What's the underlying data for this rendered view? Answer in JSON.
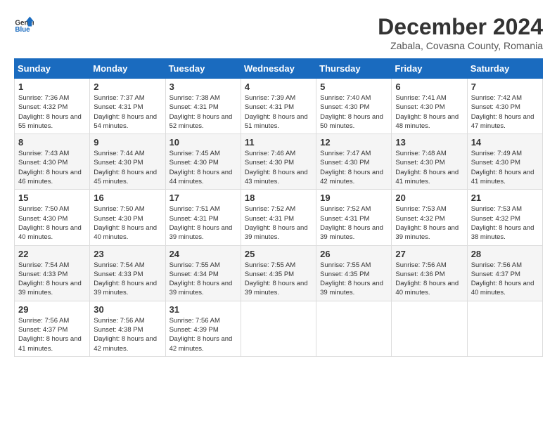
{
  "logo": {
    "general": "General",
    "blue": "Blue"
  },
  "title": "December 2024",
  "location": "Zabala, Covasna County, Romania",
  "days_header": [
    "Sunday",
    "Monday",
    "Tuesday",
    "Wednesday",
    "Thursday",
    "Friday",
    "Saturday"
  ],
  "weeks": [
    [
      {
        "day": "1",
        "sunrise": "7:36 AM",
        "sunset": "4:32 PM",
        "daylight": "8 hours and 55 minutes."
      },
      {
        "day": "2",
        "sunrise": "7:37 AM",
        "sunset": "4:31 PM",
        "daylight": "8 hours and 54 minutes."
      },
      {
        "day": "3",
        "sunrise": "7:38 AM",
        "sunset": "4:31 PM",
        "daylight": "8 hours and 52 minutes."
      },
      {
        "day": "4",
        "sunrise": "7:39 AM",
        "sunset": "4:31 PM",
        "daylight": "8 hours and 51 minutes."
      },
      {
        "day": "5",
        "sunrise": "7:40 AM",
        "sunset": "4:30 PM",
        "daylight": "8 hours and 50 minutes."
      },
      {
        "day": "6",
        "sunrise": "7:41 AM",
        "sunset": "4:30 PM",
        "daylight": "8 hours and 48 minutes."
      },
      {
        "day": "7",
        "sunrise": "7:42 AM",
        "sunset": "4:30 PM",
        "daylight": "8 hours and 47 minutes."
      }
    ],
    [
      {
        "day": "8",
        "sunrise": "7:43 AM",
        "sunset": "4:30 PM",
        "daylight": "8 hours and 46 minutes."
      },
      {
        "day": "9",
        "sunrise": "7:44 AM",
        "sunset": "4:30 PM",
        "daylight": "8 hours and 45 minutes."
      },
      {
        "day": "10",
        "sunrise": "7:45 AM",
        "sunset": "4:30 PM",
        "daylight": "8 hours and 44 minutes."
      },
      {
        "day": "11",
        "sunrise": "7:46 AM",
        "sunset": "4:30 PM",
        "daylight": "8 hours and 43 minutes."
      },
      {
        "day": "12",
        "sunrise": "7:47 AM",
        "sunset": "4:30 PM",
        "daylight": "8 hours and 42 minutes."
      },
      {
        "day": "13",
        "sunrise": "7:48 AM",
        "sunset": "4:30 PM",
        "daylight": "8 hours and 41 minutes."
      },
      {
        "day": "14",
        "sunrise": "7:49 AM",
        "sunset": "4:30 PM",
        "daylight": "8 hours and 41 minutes."
      }
    ],
    [
      {
        "day": "15",
        "sunrise": "7:50 AM",
        "sunset": "4:30 PM",
        "daylight": "8 hours and 40 minutes."
      },
      {
        "day": "16",
        "sunrise": "7:50 AM",
        "sunset": "4:30 PM",
        "daylight": "8 hours and 40 minutes."
      },
      {
        "day": "17",
        "sunrise": "7:51 AM",
        "sunset": "4:31 PM",
        "daylight": "8 hours and 39 minutes."
      },
      {
        "day": "18",
        "sunrise": "7:52 AM",
        "sunset": "4:31 PM",
        "daylight": "8 hours and 39 minutes."
      },
      {
        "day": "19",
        "sunrise": "7:52 AM",
        "sunset": "4:31 PM",
        "daylight": "8 hours and 39 minutes."
      },
      {
        "day": "20",
        "sunrise": "7:53 AM",
        "sunset": "4:32 PM",
        "daylight": "8 hours and 39 minutes."
      },
      {
        "day": "21",
        "sunrise": "7:53 AM",
        "sunset": "4:32 PM",
        "daylight": "8 hours and 38 minutes."
      }
    ],
    [
      {
        "day": "22",
        "sunrise": "7:54 AM",
        "sunset": "4:33 PM",
        "daylight": "8 hours and 39 minutes."
      },
      {
        "day": "23",
        "sunrise": "7:54 AM",
        "sunset": "4:33 PM",
        "daylight": "8 hours and 39 minutes."
      },
      {
        "day": "24",
        "sunrise": "7:55 AM",
        "sunset": "4:34 PM",
        "daylight": "8 hours and 39 minutes."
      },
      {
        "day": "25",
        "sunrise": "7:55 AM",
        "sunset": "4:35 PM",
        "daylight": "8 hours and 39 minutes."
      },
      {
        "day": "26",
        "sunrise": "7:55 AM",
        "sunset": "4:35 PM",
        "daylight": "8 hours and 39 minutes."
      },
      {
        "day": "27",
        "sunrise": "7:56 AM",
        "sunset": "4:36 PM",
        "daylight": "8 hours and 40 minutes."
      },
      {
        "day": "28",
        "sunrise": "7:56 AM",
        "sunset": "4:37 PM",
        "daylight": "8 hours and 40 minutes."
      }
    ],
    [
      {
        "day": "29",
        "sunrise": "7:56 AM",
        "sunset": "4:37 PM",
        "daylight": "8 hours and 41 minutes."
      },
      {
        "day": "30",
        "sunrise": "7:56 AM",
        "sunset": "4:38 PM",
        "daylight": "8 hours and 42 minutes."
      },
      {
        "day": "31",
        "sunrise": "7:56 AM",
        "sunset": "4:39 PM",
        "daylight": "8 hours and 42 minutes."
      },
      null,
      null,
      null,
      null
    ]
  ]
}
